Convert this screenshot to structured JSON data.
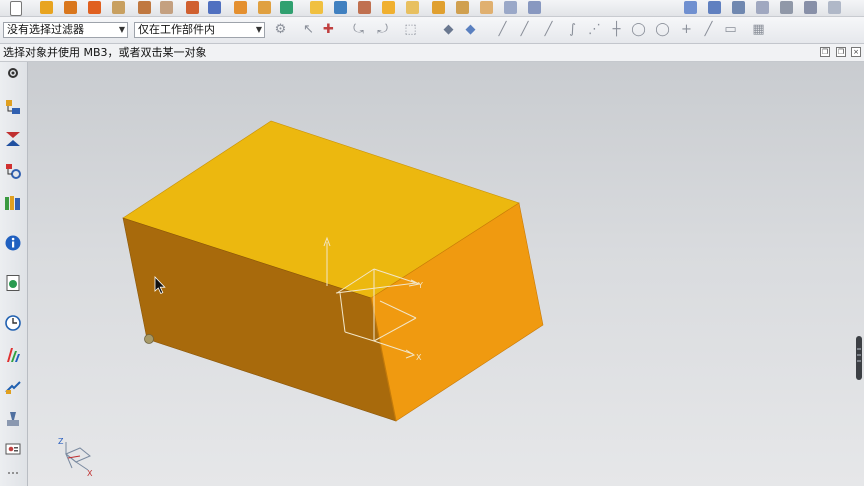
{
  "filters": {
    "type_filter": "没有选择过滤器",
    "scope_filter": "仅在工作部件内"
  },
  "status": {
    "prompt": "选择对象并使用 MB3，或者双击某一对象"
  },
  "csys": {
    "x_label": "X",
    "y_label": "Y",
    "z_label": "Z"
  },
  "colors": {
    "block_top": "#ecb80f",
    "block_front": "#a86a0c",
    "block_side": "#f09a10",
    "viewport_bg": "#d9dbde"
  },
  "icons": {
    "resource_bar": [
      "settings-icon",
      "assembly-navigator-icon",
      "constraint-navigator-icon",
      "part-navigator-icon",
      "reuse-library-icon",
      "info-icon",
      "web-browser-icon",
      "history-icon",
      "visualization-icon",
      "process-studio-icon",
      "manufacturing-icon",
      "roles-icon"
    ]
  }
}
